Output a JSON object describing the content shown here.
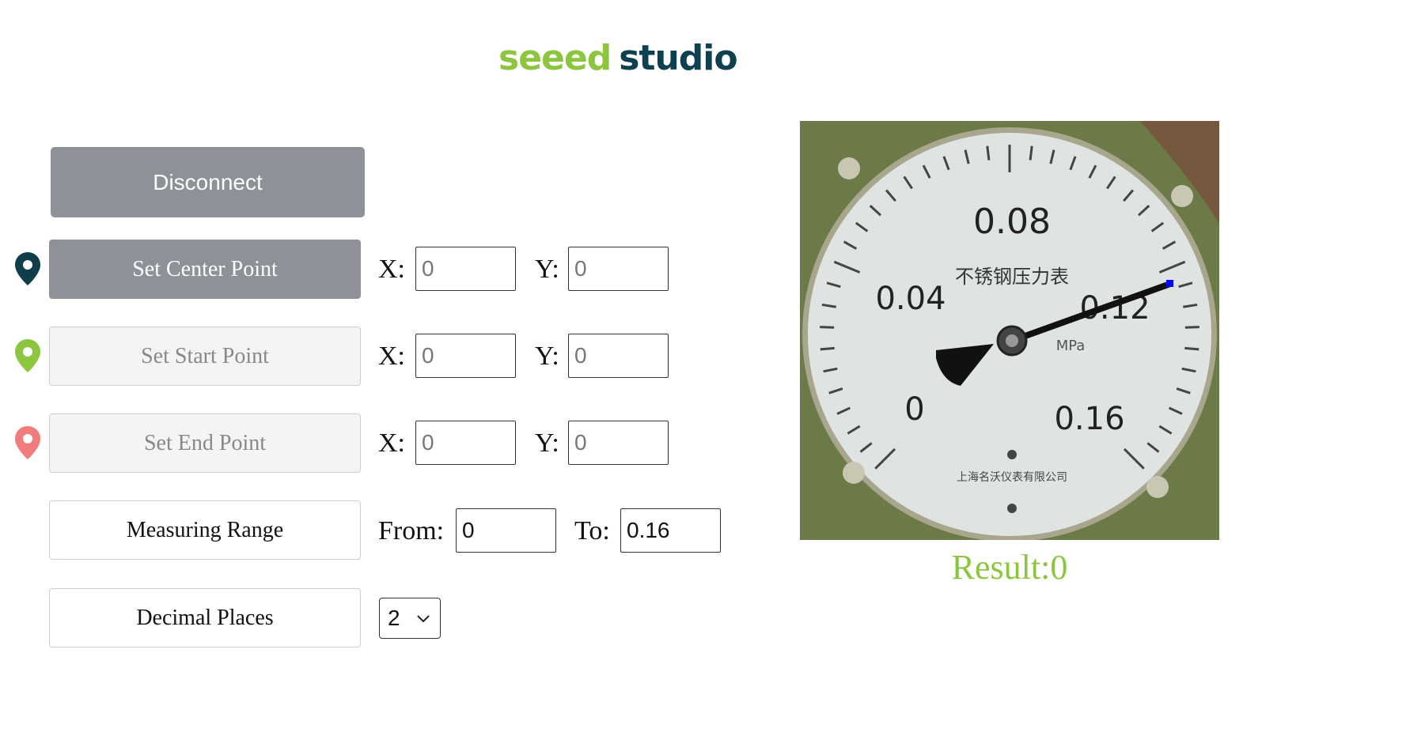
{
  "logo": {
    "part1": "seeed",
    "part2": "studio"
  },
  "buttons": {
    "disconnect": "Disconnect",
    "set_center": "Set Center Point",
    "set_start": "Set Start Point",
    "set_end": "Set End Point",
    "measuring_range": "Measuring Range",
    "decimal_places": "Decimal Places"
  },
  "labels": {
    "x": "X:",
    "y": "Y:",
    "from": "From:",
    "to": "To:"
  },
  "center": {
    "x": "0",
    "y": "0"
  },
  "start": {
    "x": "0",
    "y": "0"
  },
  "end": {
    "x": "0",
    "y": "0"
  },
  "range": {
    "from": "0",
    "to": "0.16"
  },
  "decimal": {
    "value": "2"
  },
  "gauge": {
    "scale_labels": [
      "0",
      "0.04",
      "0.08",
      "0.12",
      "0.16"
    ],
    "title": "不锈钢压力表",
    "unit": "MPa",
    "maker": "上海名沃仪表有限公司"
  },
  "result": {
    "text": "Result:0"
  },
  "colors": {
    "accent": "#8cc63f",
    "brand_dark": "#0f4050",
    "button_gray": "#8e9198",
    "pin_center": "#0f3d4a",
    "pin_start": "#8cc63f",
    "pin_end": "#f27b7b"
  }
}
